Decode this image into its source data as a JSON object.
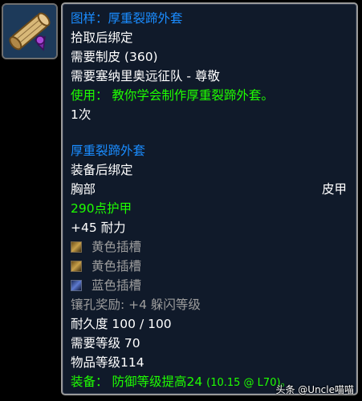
{
  "item": {
    "title": "图样：厚重裂蹄外套",
    "bind": "拾取后绑定",
    "requires_skill": "需要制皮 (360)",
    "requires_rep": "需要塞纳里奥远征队 - 尊敬",
    "use_text": "使用： 教你学会制作厚重裂蹄外套。",
    "charges": "1次"
  },
  "crafted": {
    "name": "厚重裂蹄外套",
    "bind": "装备后绑定",
    "slot": "胸部",
    "armor_type": "皮甲",
    "armor": "290点护甲",
    "stamina": "+45 耐力",
    "sockets": [
      {
        "label": "黄色插槽",
        "color": "yellow"
      },
      {
        "label": "黄色插槽",
        "color": "yellow"
      },
      {
        "label": "蓝色插槽",
        "color": "blue"
      }
    ],
    "socket_bonus": "镶孔奖励: +4 躲闪等级",
    "durability": "耐久度 100 / 100",
    "required_level": "需要等级 70",
    "item_level": "物品等级114",
    "equip_prefix": "装备：",
    "equip_effect": "防御等级提高24",
    "equip_detail": "(10.15 @ L70)。"
  },
  "watermark": "头条 @Uncle喵喵",
  "icon": "scroll-recipe-icon",
  "colors": {
    "background": "#000000",
    "tooltip_bg": "#101a2a",
    "border": "#9a9a9a",
    "title_blue": "#1a8cff",
    "green": "#1eff00",
    "grey": "#9d9d9d"
  }
}
